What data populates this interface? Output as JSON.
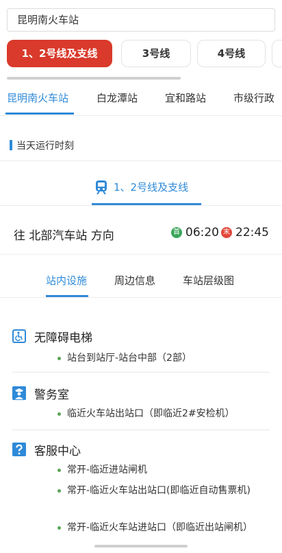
{
  "search": {
    "value": "昆明南火车站"
  },
  "line_tabs": [
    {
      "label": "1、2号线及支线",
      "active": true
    },
    {
      "label": "3号线"
    },
    {
      "label": "4号线"
    }
  ],
  "station_tabs": [
    "昆明南火车站",
    "白龙潭站",
    "宜和路站",
    "市级行政"
  ],
  "section_title": "当天运行时刻",
  "current_line": "1、2号线及支线",
  "direction": "往 北部汽车站 方向",
  "first_badge": "首",
  "first_time": "06:20",
  "last_badge": "末",
  "last_time": "22:45",
  "facility_tabs": [
    "站内设施",
    "周边信息",
    "车站层级图"
  ],
  "facilities": [
    {
      "name": "无障碍电梯",
      "icon": "accessible-elevator-icon",
      "items": [
        "站台到站厅-站台中部（2部）"
      ]
    },
    {
      "name": "警务室",
      "icon": "police-icon",
      "items": [
        "临近火车站出站口（即临近2#安检机）"
      ]
    },
    {
      "name": "客服中心",
      "icon": "help-icon",
      "items": [
        "常开-临近进站闸机",
        "常开-临近火车站出站口(即临近自动售票机)",
        "常开-临近火车站进站口（即临近出站闸机）"
      ]
    }
  ],
  "colors": {
    "accent_red": "#d93a2b",
    "accent_blue": "#2f8ad8",
    "first_green": "#3aa55a",
    "last_red": "#e2463a",
    "bullet_green": "#5aa557"
  }
}
